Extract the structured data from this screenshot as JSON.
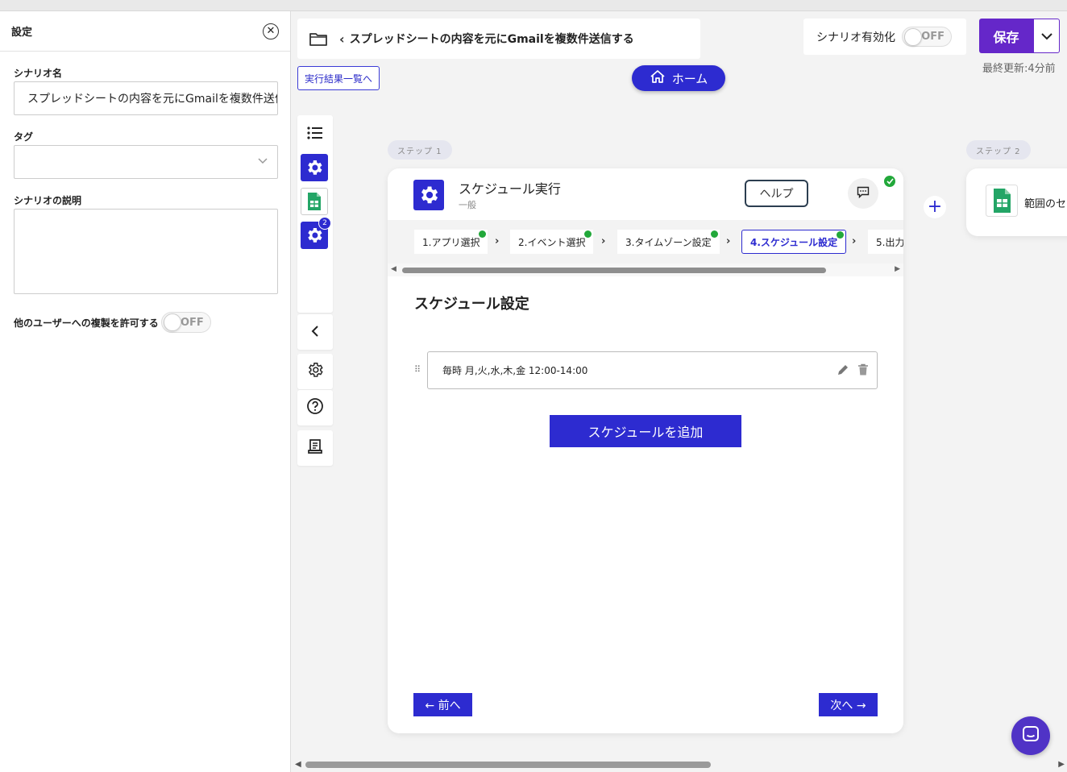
{
  "settings": {
    "title": "設定",
    "name_label": "シナリオ名",
    "name_value": "スプレッドシートの内容を元にGmailを複数件送信する",
    "tag_label": "タグ",
    "description_label": "シナリオの説明",
    "copy_permission_label": "他のユーザーへの複製を許可する",
    "copy_permission_state": "OFF"
  },
  "header": {
    "scenario_title": "スプレッドシートの内容を元にGmailを複数件送信する",
    "results_link": "実行結果一覧へ",
    "home_label": "ホーム",
    "activate_label": "シナリオ有効化",
    "activate_state": "OFF",
    "save_label": "保存",
    "last_updated": "最終更新:4分前"
  },
  "toolbar": {
    "step_badge": "2"
  },
  "steps": {
    "step1_pill": "ステップ 1",
    "step2_pill": "ステップ 2"
  },
  "card": {
    "title": "スケジュール実行",
    "subtitle": "一般",
    "help_label": "ヘルプ",
    "tabs": [
      {
        "label": "1.アプリ選択",
        "done": true
      },
      {
        "label": "2.イベント選択",
        "done": true
      },
      {
        "label": "3.タイムゾーン設定",
        "done": true
      },
      {
        "label": "4.スケジュール設定",
        "done": true,
        "active": true
      },
      {
        "label": "5.出力",
        "done": false
      }
    ],
    "section_title": "スケジュール設定",
    "schedule_entry": "毎時 月,火,水,木,金 12:00-14:00",
    "add_schedule_label": "スケジュールを追加",
    "prev_label": "← 前へ",
    "next_label": "次へ →"
  },
  "card2": {
    "title": "範囲のセ"
  },
  "colors": {
    "primary": "#2d2bd0",
    "save": "#6527c9",
    "success": "#22a83a",
    "chat": "#5033c6"
  }
}
